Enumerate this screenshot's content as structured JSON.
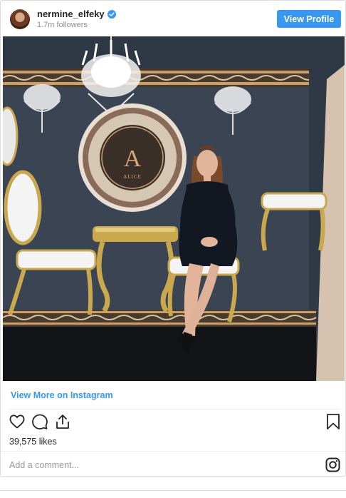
{
  "post": {
    "username": "nermine_elfeky",
    "followers": "1.7m followers",
    "view_profile_label": "View Profile",
    "image_sign_letter": "A",
    "image_sign_text": "ALICE",
    "view_more_label": "View More on Instagram",
    "likes": "39,575 likes",
    "comment_placeholder": "Add a comment..."
  },
  "icons": {
    "verified": "verified-badge-icon",
    "like": "heart-icon",
    "comment": "speech-bubble-icon",
    "share": "share-icon",
    "save": "bookmark-icon",
    "instagram": "instagram-icon"
  },
  "colors": {
    "accent": "#3897f0",
    "text": "#262626",
    "muted": "#8e8e8e"
  }
}
